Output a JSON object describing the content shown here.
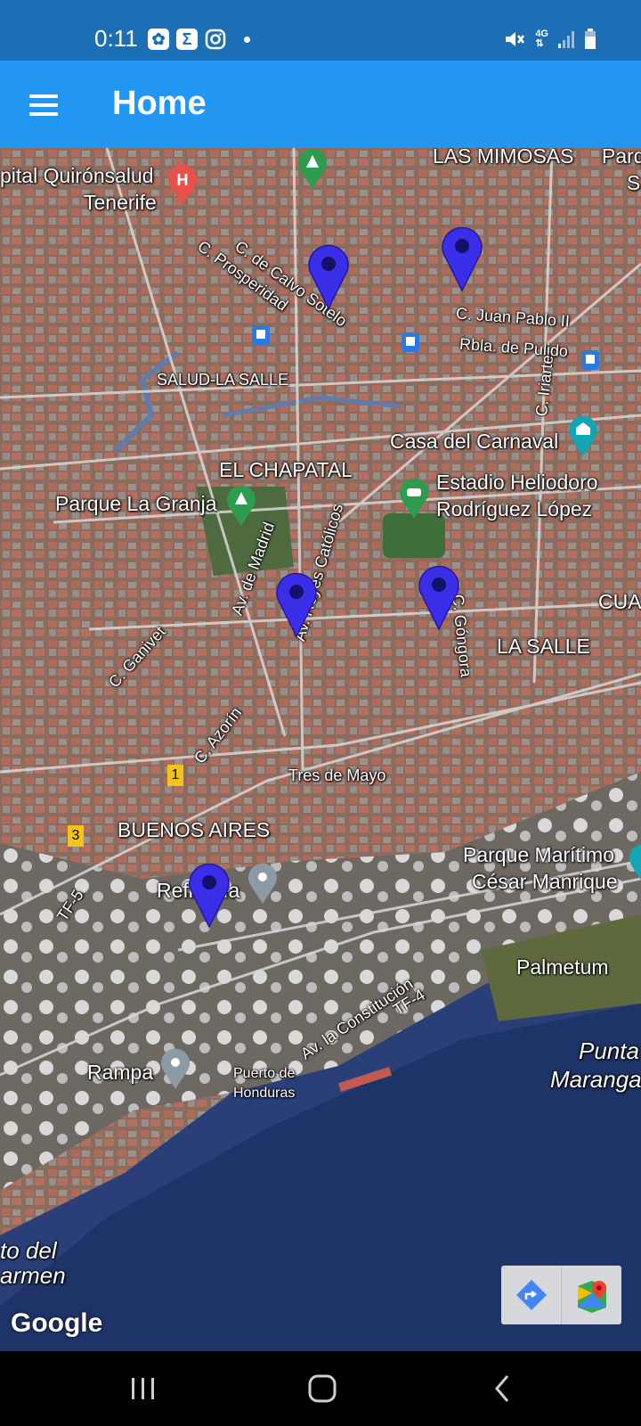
{
  "status_bar": {
    "time": "0:11",
    "left_icons": [
      "app-icon",
      "sigma-icon",
      "instagram-icon",
      "notification-dot"
    ],
    "right_icons": [
      "mute-icon",
      "4g-icon",
      "signal-icon",
      "battery-icon"
    ],
    "network": "4G"
  },
  "app_bar": {
    "title": "Home",
    "menu_icon": "hamburger-menu-icon",
    "color": "#2196f3"
  },
  "map": {
    "labels": {
      "hospital": "pital Quirónsalud",
      "hospital_line2": "Tenerife",
      "las_mimosas": "LAS MIMOSAS",
      "parq": "Parq",
      "parq_s": "S",
      "c_de_calvo": "C. de Calvo Sotelo",
      "c_prosperidad": "C. Prosperidad",
      "c_juan_pablo": "C. Juan Pablo II",
      "rbla_pulido": "Rbla. de Pulido",
      "salud_la_salle": "SALUD-LA SALLE",
      "c_iriarte": "C. Iriarte",
      "casa_carnaval": "Casa del Carnaval",
      "el_chapatal": "EL CHAPATAL",
      "estadio_1": "Estadio Heliodoro",
      "estadio_2": "Rodríguez López",
      "parque_granja": "Parque La Granja",
      "av_madrid": "Av. de Madrid",
      "reyes_catolicos": "Av. Reyes Católicos",
      "cua": "CUA",
      "c_gongora": "C. Góngora",
      "la_salle": "LA SALLE",
      "c_ganivet": "C. Ganivet",
      "c_azorin": "C. Azorín",
      "tres_de_mayo": "Tres de Mayo",
      "buenos_aires": "BUENOS AIRES",
      "tf5": "TF-5",
      "refineria": "Refinería",
      "parque_maritimo_1": "Parque Marítimo",
      "parque_maritimo_2": "César Manrique",
      "palmetum": "Palmetum",
      "av_constitucion": "Av. la Constitución",
      "tf4": "TF-4",
      "rampa": "Rampa",
      "puerto_1": "Puerto de",
      "puerto_2": "Honduras",
      "punta_1": "Punta",
      "punta_2": "Maranga",
      "carmen_1": "to del",
      "carmen_2": "armen",
      "road_1": "1",
      "road_3": "3",
      "hospital_badge": "H"
    },
    "markers": [
      {
        "name": "marker-1",
        "color": "#3a2ee8"
      },
      {
        "name": "marker-2",
        "color": "#3a2ee8"
      },
      {
        "name": "marker-3",
        "color": "#3a2ee8"
      },
      {
        "name": "marker-4",
        "color": "#3a2ee8"
      },
      {
        "name": "marker-5",
        "color": "#3a2ee8"
      }
    ],
    "attribution": "Google",
    "tools": [
      "directions-icon",
      "google-maps-icon"
    ]
  },
  "nav_bar": {
    "buttons": [
      "recents-button",
      "home-button",
      "back-button"
    ]
  }
}
